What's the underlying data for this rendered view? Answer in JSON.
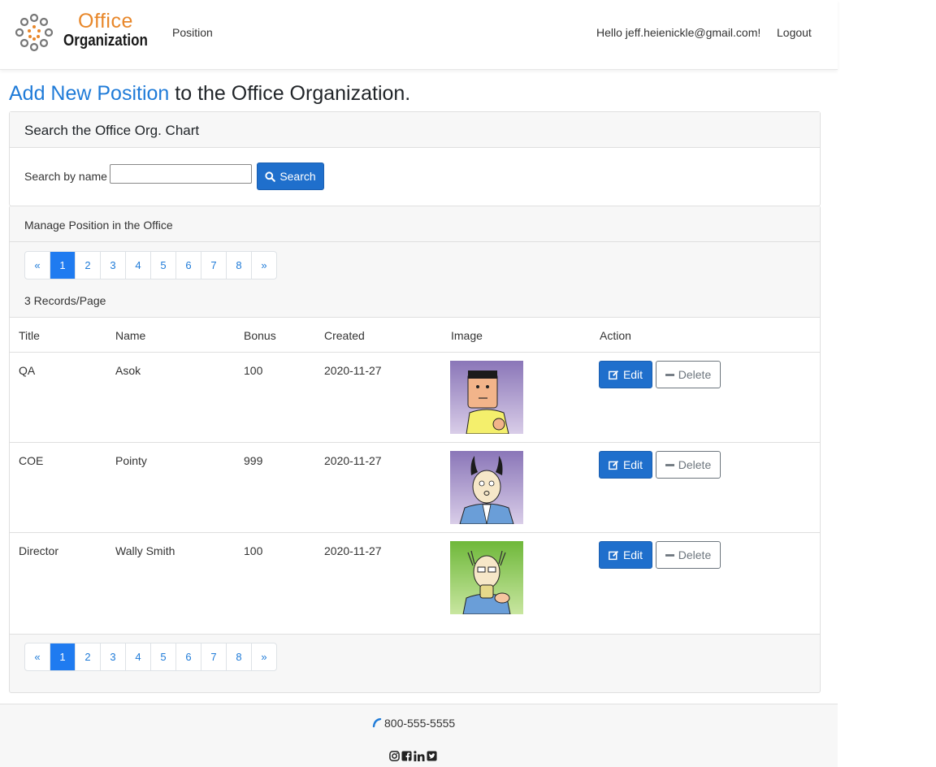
{
  "header": {
    "logo": {
      "word1": "Office",
      "word2": "Organization"
    },
    "nav_position": "Position",
    "greeting": "Hello jeff.heienickle@gmail.com!",
    "logout": "Logout"
  },
  "title": {
    "highlight": "Add New Position",
    "rest": " to the Office Organization."
  },
  "search": {
    "heading": "Search the Office Org. Chart",
    "label": "Search by name",
    "value": "",
    "button": "Search"
  },
  "manage": {
    "heading": "Manage Position in the Office",
    "records_per_page": "3 Records/Page",
    "pagination": [
      "«",
      "1",
      "2",
      "3",
      "4",
      "5",
      "6",
      "7",
      "8",
      "»"
    ],
    "active_page": "1"
  },
  "table": {
    "columns": [
      "Title",
      "Name",
      "Bonus",
      "Created",
      "Image",
      "Action"
    ],
    "rows": [
      {
        "title": "QA",
        "name": "Asok",
        "bonus": "100",
        "created": "2020-11-27",
        "image": "asok-avatar"
      },
      {
        "title": "COE",
        "name": "Pointy",
        "bonus": "999",
        "created": "2020-11-27",
        "image": "pointy-avatar"
      },
      {
        "title": "Director",
        "name": "Wally Smith",
        "bonus": "100",
        "created": "2020-11-27",
        "image": "wally-avatar"
      }
    ],
    "edit_label": "Edit",
    "delete_label": "Delete"
  },
  "footer": {
    "phone": "800-555-5555",
    "social": [
      "instagram-icon",
      "facebook-icon",
      "linkedin-icon",
      "twitter-icon"
    ]
  },
  "colors": {
    "accent": "#1f7bd8",
    "button": "#1f6fcc",
    "logo_orange": "#e8872a"
  }
}
